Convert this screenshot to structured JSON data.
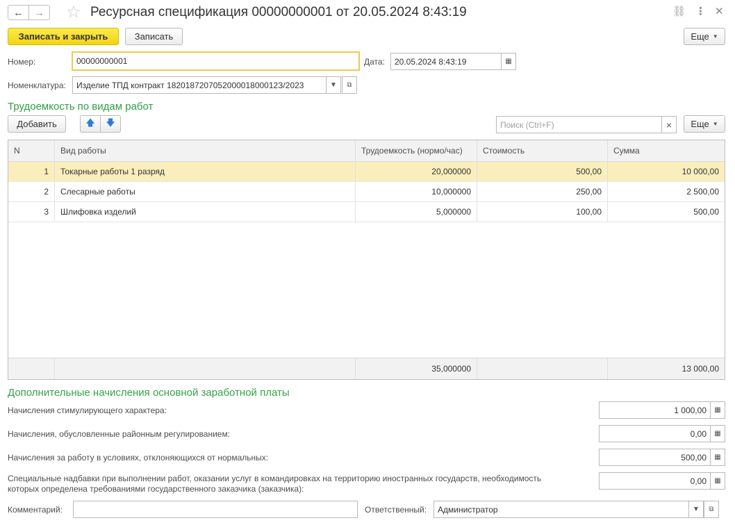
{
  "window": {
    "title": "Ресурсная спецификация 00000000001 от 20.05.2024 8:43:19",
    "back_icon": "←",
    "forward_icon": "→",
    "favorite_icon": "☆",
    "link_icon": "⛓",
    "menu_icon": "⋮",
    "close_icon": "✕"
  },
  "toolbar": {
    "save_close_label": "Записать и закрыть",
    "save_label": "Записать",
    "more_label": "Еще"
  },
  "header": {
    "number_label": "Номер:",
    "number_value": "00000000001",
    "date_label": "Дата:",
    "date_value": "20.05.2024  8:43:19",
    "nomenclature_label": "Номенклатура:",
    "nomenclature_value": "Изделие ТПД контракт 182018720705200001800012З/2023"
  },
  "labor": {
    "section_title": "Трудоемкость по видам работ",
    "add_label": "Добавить",
    "up_icon": "🡅",
    "down_icon": "🡇",
    "search_placeholder": "Поиск (Ctrl+F)",
    "clear_icon": "×",
    "more_label": "Еще",
    "columns": [
      "N",
      "Вид работы",
      "Трудоемкость (нормо/час)",
      "Стоимость",
      "Сумма"
    ],
    "rows": [
      {
        "n": "1",
        "work": "Токарные работы 1 разряд",
        "labor": "20,000000",
        "cost": "500,00",
        "sum": "10 000,00"
      },
      {
        "n": "2",
        "work": "Слесарные работы",
        "labor": "10,000000",
        "cost": "250,00",
        "sum": "2 500,00"
      },
      {
        "n": "3",
        "work": "Шлифовка изделий",
        "labor": "5,000000",
        "cost": "100,00",
        "sum": "500,00"
      }
    ],
    "total_labor": "35,000000",
    "total_sum": "13 000,00"
  },
  "extra": {
    "section_title": "Дополнительные начисления основной заработной платы",
    "items": [
      {
        "label": "Начисления стимулирующего характера:",
        "value": "1 000,00"
      },
      {
        "label": "Начисления, обусловленные районным регулированием:",
        "value": "0,00"
      },
      {
        "label": "Начисления за работу в условиях, отклоняющихся от нормальных:",
        "value": "500,00"
      },
      {
        "label_line1": "Специальные надбавки при выполнении работ, оказании услуг в командировках на территорию иностранных государств, необходимость",
        "label_line2": "которых определена требованиями государственного заказчика (заказчика):",
        "value": "0,00"
      }
    ]
  },
  "footer": {
    "comment_label": "Комментарий:",
    "comment_value": "",
    "responsible_label": "Ответственный:",
    "responsible_value": "Администратор"
  }
}
